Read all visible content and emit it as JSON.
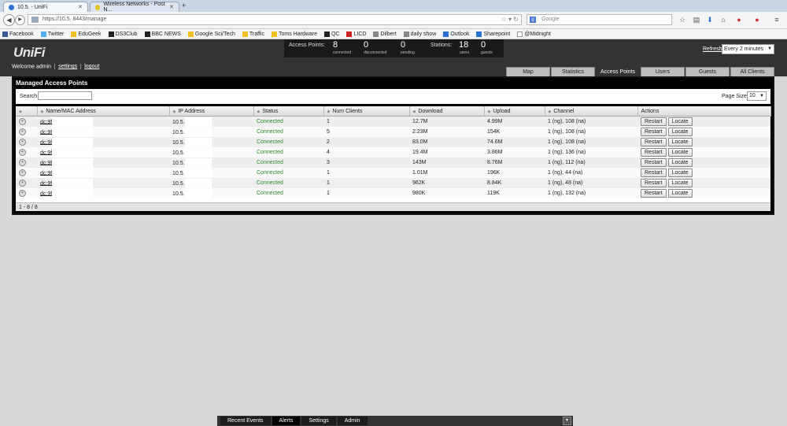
{
  "browser": {
    "tabs": [
      {
        "label": "10.5.            - UniFi",
        "active": true
      },
      {
        "label": "Wireless Networks - Post N...",
        "active": false
      }
    ],
    "new_tab": "+",
    "url": "https://10.5.          8443/manage",
    "search_placeholder": "Google",
    "bookmarks": [
      {
        "label": "Facebook",
        "color": "#3b5998"
      },
      {
        "label": "Twitter",
        "color": "#55acee"
      },
      {
        "label": "EduGeek",
        "color": "#f0c020"
      },
      {
        "label": "DS3Club",
        "color": "#222222"
      },
      {
        "label": "BBC NEWS",
        "color": "#222222"
      },
      {
        "label": "Google Sci/Tech",
        "color": "#f0c020"
      },
      {
        "label": "Traffic",
        "color": "#f0c020"
      },
      {
        "label": "Toms Hardware",
        "color": "#f0c020"
      },
      {
        "label": "QC",
        "color": "#222222"
      },
      {
        "label": "LICD",
        "color": "#cc2222"
      },
      {
        "label": "Dilbert",
        "color": "#888888"
      },
      {
        "label": "daily show",
        "color": "#888888"
      },
      {
        "label": "Outlook",
        "color": "#2a6fd1"
      },
      {
        "label": "Sharepoint",
        "color": "#2a6fd1"
      },
      {
        "label": "@Midnight",
        "color": "#ffffff"
      }
    ]
  },
  "app": {
    "logo": "UniFi",
    "welcome": "Welcome admin",
    "settings_link": "settings",
    "logout_link": "logout",
    "stats": {
      "ap_label": "Access Points:",
      "connected": "8",
      "connected_label": "connected",
      "disconnected": "0",
      "disconnected_label": "disconnected",
      "pending": "0",
      "pending_label": "pending",
      "stations_label": "Stations:",
      "users": "18",
      "users_label": "users",
      "guests": "0",
      "guests_label": "guests"
    },
    "refresh_label": "Refresh",
    "refresh_value": "Every 2 minutes",
    "nav_tabs": [
      "Map",
      "Statistics",
      "Access Points",
      "Users",
      "Guests",
      "All Clients"
    ],
    "active_tab": "Access Points"
  },
  "panel": {
    "title": "Managed Access Points",
    "search_label": "Search",
    "search_value": "",
    "page_size_label": "Page Size",
    "page_size": "10",
    "columns": [
      "",
      "Name/MAC Address",
      "IP Address",
      "Status",
      "Num Clients",
      "Download",
      "Upload",
      "Channel",
      "Actions"
    ],
    "rows": [
      {
        "mac": "dc:9f",
        "ip": "10.5.",
        "status": "Connected",
        "clients": "1",
        "download": "12.7M",
        "upload": "4.99M",
        "channel": "1 (ng), 108 (na)"
      },
      {
        "mac": "dc:9f",
        "ip": "10.5.",
        "status": "Connected",
        "clients": "5",
        "download": "2.23M",
        "upload": "154K",
        "channel": "1 (ng), 108 (na)"
      },
      {
        "mac": "dc:9f",
        "ip": "10.5.",
        "status": "Connected",
        "clients": "2",
        "download": "83.0M",
        "upload": "74.6M",
        "channel": "1 (ng), 108 (na)"
      },
      {
        "mac": "dc:9f",
        "ip": "10.5.",
        "status": "Connected",
        "clients": "4",
        "download": "19.4M",
        "upload": "3.86M",
        "channel": "1 (ng), 136 (na)"
      },
      {
        "mac": "dc:9f",
        "ip": "10.5.",
        "status": "Connected",
        "clients": "3",
        "download": "143M",
        "upload": "8.76M",
        "channel": "1 (ng), 112 (na)"
      },
      {
        "mac": "dc:9f",
        "ip": "10.5.",
        "status": "Connected",
        "clients": "1",
        "download": "1.01M",
        "upload": "196K",
        "channel": "1 (ng), 44 (na)"
      },
      {
        "mac": "dc:9f",
        "ip": "10.5.",
        "status": "Connected",
        "clients": "1",
        "download": "962K",
        "upload": "8.84K",
        "channel": "1 (ng), 48 (na)"
      },
      {
        "mac": "dc:9f",
        "ip": "10.5.",
        "status": "Connected",
        "clients": "1",
        "download": "980K",
        "upload": "119K",
        "channel": "1 (ng), 132 (na)"
      }
    ],
    "restart_label": "Restart",
    "locate_label": "Locate",
    "footer": "1 - 8 / 8"
  },
  "bottom_tabs": [
    "Recent Events",
    "Alerts",
    "Settings",
    "Admin"
  ],
  "bottom_active": "Alerts"
}
